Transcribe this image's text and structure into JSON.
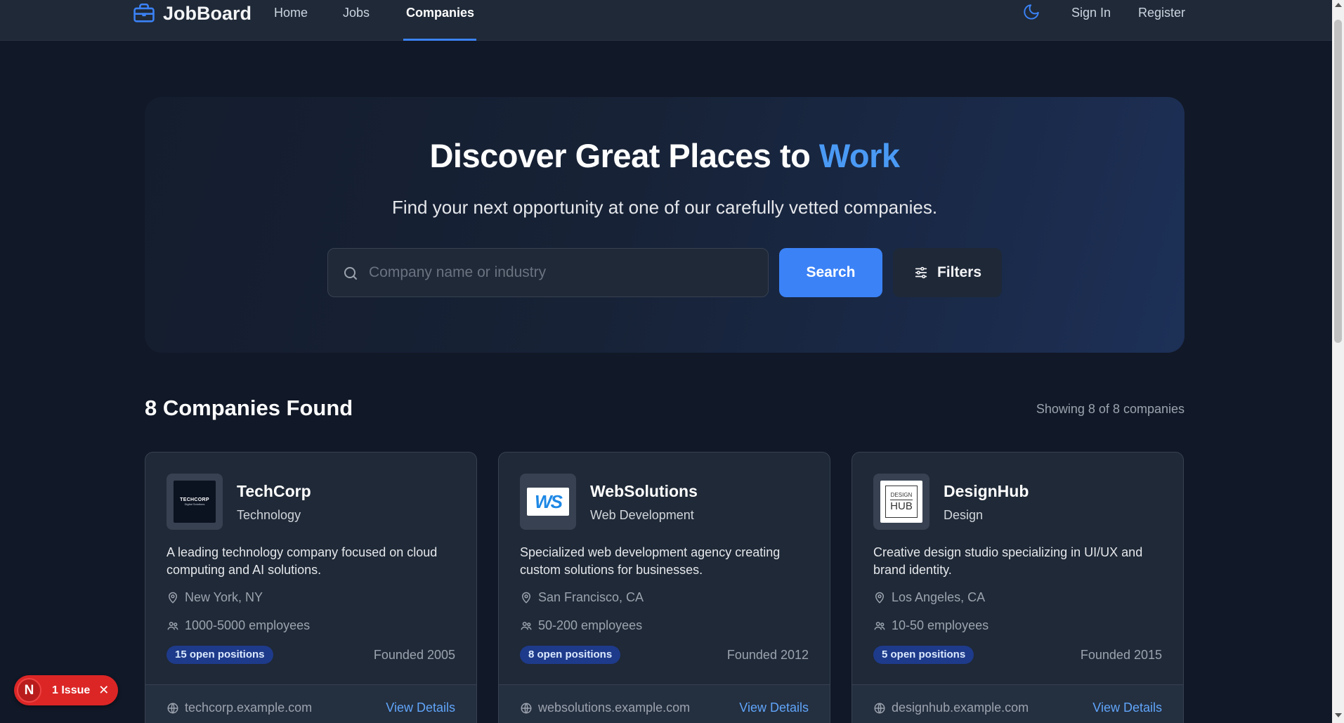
{
  "nav": {
    "brand": "JobBoard",
    "links": [
      "Home",
      "Jobs",
      "Companies"
    ],
    "active": "Companies",
    "sign_in": "Sign In",
    "register": "Register"
  },
  "hero": {
    "title_main": "Discover Great Places to ",
    "title_accent": "Work",
    "subtitle": "Find your next opportunity at one of our carefully vetted companies.",
    "search_placeholder": "Company name or industry",
    "search_value": "",
    "search_button": "Search",
    "filters_button": "Filters"
  },
  "results": {
    "title": "8 Companies Found",
    "count": "Showing 8 of 8 companies"
  },
  "companies": [
    {
      "name": "TechCorp",
      "industry": "Technology",
      "description": "A leading technology company focused on cloud computing and AI solutions.",
      "location": "New York, NY",
      "employees": "1000-5000 employees",
      "open_positions": "15 open positions",
      "founded": "Founded 2005",
      "website": "techcorp.example.com",
      "view_details": "View Details",
      "logo_text": "TECHCORP",
      "logo_subtext": "Digital Solutions"
    },
    {
      "name": "WebSolutions",
      "industry": "Web Development",
      "description": "Specialized web development agency creating custom solutions for businesses.",
      "location": "San Francisco, CA",
      "employees": "50-200 employees",
      "open_positions": "8 open positions",
      "founded": "Founded 2012",
      "website": "websolutions.example.com",
      "view_details": "View Details",
      "logo_text": "WS"
    },
    {
      "name": "DesignHub",
      "industry": "Design",
      "description": "Creative design studio specializing in UI/UX and brand identity.",
      "location": "Los Angeles, CA",
      "employees": "10-50 employees",
      "open_positions": "5 open positions",
      "founded": "Founded 2015",
      "website": "designhub.example.com",
      "view_details": "View Details",
      "logo_text": "DESIGN",
      "logo_subtext": "HUB"
    }
  ],
  "issue_badge": {
    "avatar": "N",
    "label": "1 Issue",
    "close": "✕"
  },
  "colors": {
    "background": "#111827",
    "nav": "#1f2937",
    "accent": "#3b82f6",
    "link": "#60a5fa",
    "issue": "#dc2626"
  }
}
